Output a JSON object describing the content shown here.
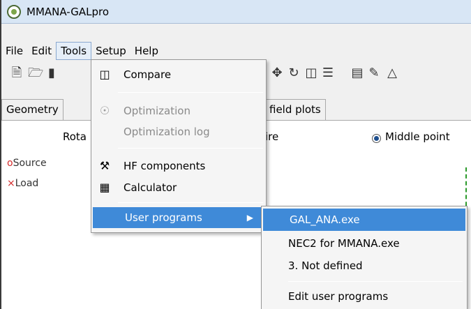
{
  "window": {
    "title": "MMANA-GALpro"
  },
  "menubar": {
    "items": [
      "File",
      "Edit",
      "Tools",
      "Setup",
      "Help"
    ]
  },
  "toolbar": {
    "icons": [
      "new-file-icon",
      "open-folder-icon",
      "save-icon",
      "move-icon",
      "rotate-icon",
      "copy-icon",
      "align-icon",
      "document-icon",
      "pencil-icon",
      "triangle-icon"
    ]
  },
  "tabs": {
    "geometry": "Geometry",
    "farfield": "field plots"
  },
  "panel": {
    "rota": "Rota",
    "wire": "ire",
    "middle_point": "Middle point",
    "source": "Source",
    "load": "Load"
  },
  "tools_menu": {
    "compare": "Compare",
    "optimization": "Optimization",
    "optimization_log": "Optimization log",
    "hf_components": "HF components",
    "calculator": "Calculator",
    "user_programs": "User programs"
  },
  "user_programs_menu": {
    "item1": "GAL_ANA.exe",
    "item2": "NEC2 for MMANA.exe",
    "item3": "3. Not defined",
    "edit": "Edit user programs"
  },
  "colors": {
    "highlight": "#3f8ad8",
    "source_marker": "#d42a2a",
    "plot_line": "#2a9a2a"
  }
}
